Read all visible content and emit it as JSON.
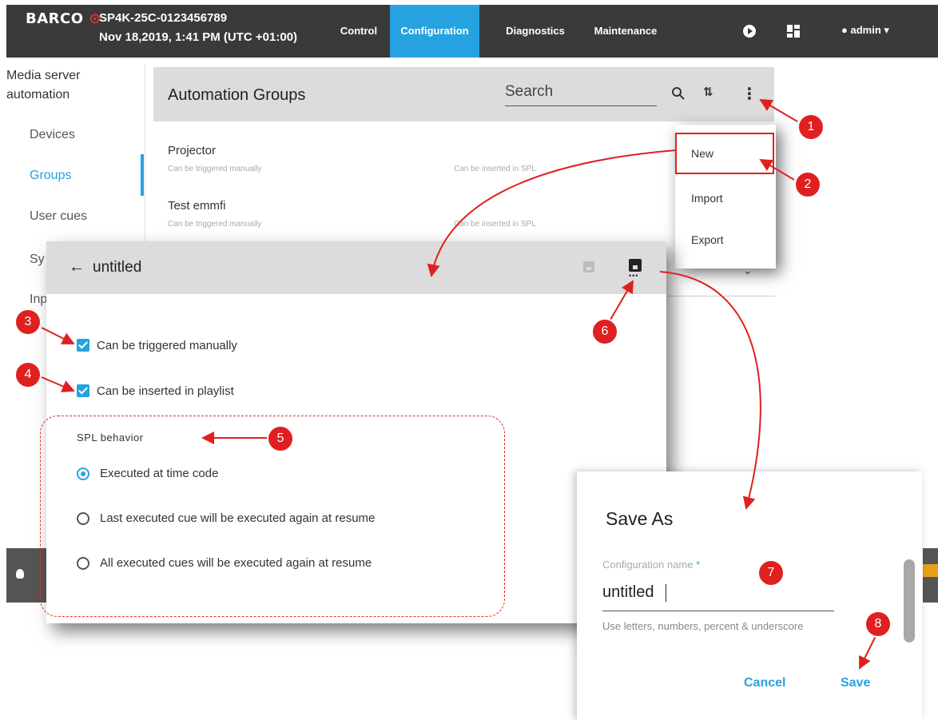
{
  "header": {
    "logo": "BARCO",
    "device_id": "SP4K-25C-0123456789",
    "datetime": "Nov 18,2019, 1:41 PM (UTC +01:00)",
    "nav": [
      "Control",
      "Configuration",
      "Diagnostics",
      "Maintenance"
    ],
    "active_nav": "Configuration",
    "user": "admin",
    "accent": "#27a2e0",
    "bar_color": "#3a3a3a"
  },
  "sidebar": {
    "title_line1": "Media server",
    "title_line2": "automation",
    "items": [
      "Devices",
      "Groups",
      "User cues",
      "Sy",
      "Inp"
    ],
    "active": "Groups"
  },
  "groups_panel": {
    "title": "Automation Groups",
    "search_placeholder": "Search",
    "rows": [
      {
        "name": "Projector",
        "trigger": "Can be triggered manually",
        "insert": "Can be inserted in SPL"
      },
      {
        "name": "Test emmfi",
        "trigger": "Can be triggered manually",
        "insert": "Can be inserted in SPL"
      }
    ]
  },
  "new_menu": {
    "items": [
      "New",
      "Import",
      "Export"
    ],
    "highlighted": "New"
  },
  "untitled_dialog": {
    "back_icon": "←",
    "title": "untitled",
    "checkboxes": [
      {
        "label": "Can be triggered manually",
        "checked": true
      },
      {
        "label": "Can be inserted in playlist",
        "checked": true
      }
    ],
    "spl": {
      "title": "SPL behavior",
      "options": [
        "Executed at time code",
        "Last executed cue will be executed again at resume",
        "All executed cues will be executed again at resume"
      ],
      "selected": 0
    }
  },
  "saveas_dialog": {
    "title": "Save As",
    "field_label": "Configuration name",
    "required_mark": "*",
    "field_value": "untitled",
    "hint": "Use letters, numbers, percent & underscore",
    "cancel": "Cancel",
    "save": "Save"
  },
  "callouts": [
    "1",
    "2",
    "3",
    "4",
    "5",
    "6",
    "7",
    "8"
  ],
  "callout_color": "#e02020"
}
